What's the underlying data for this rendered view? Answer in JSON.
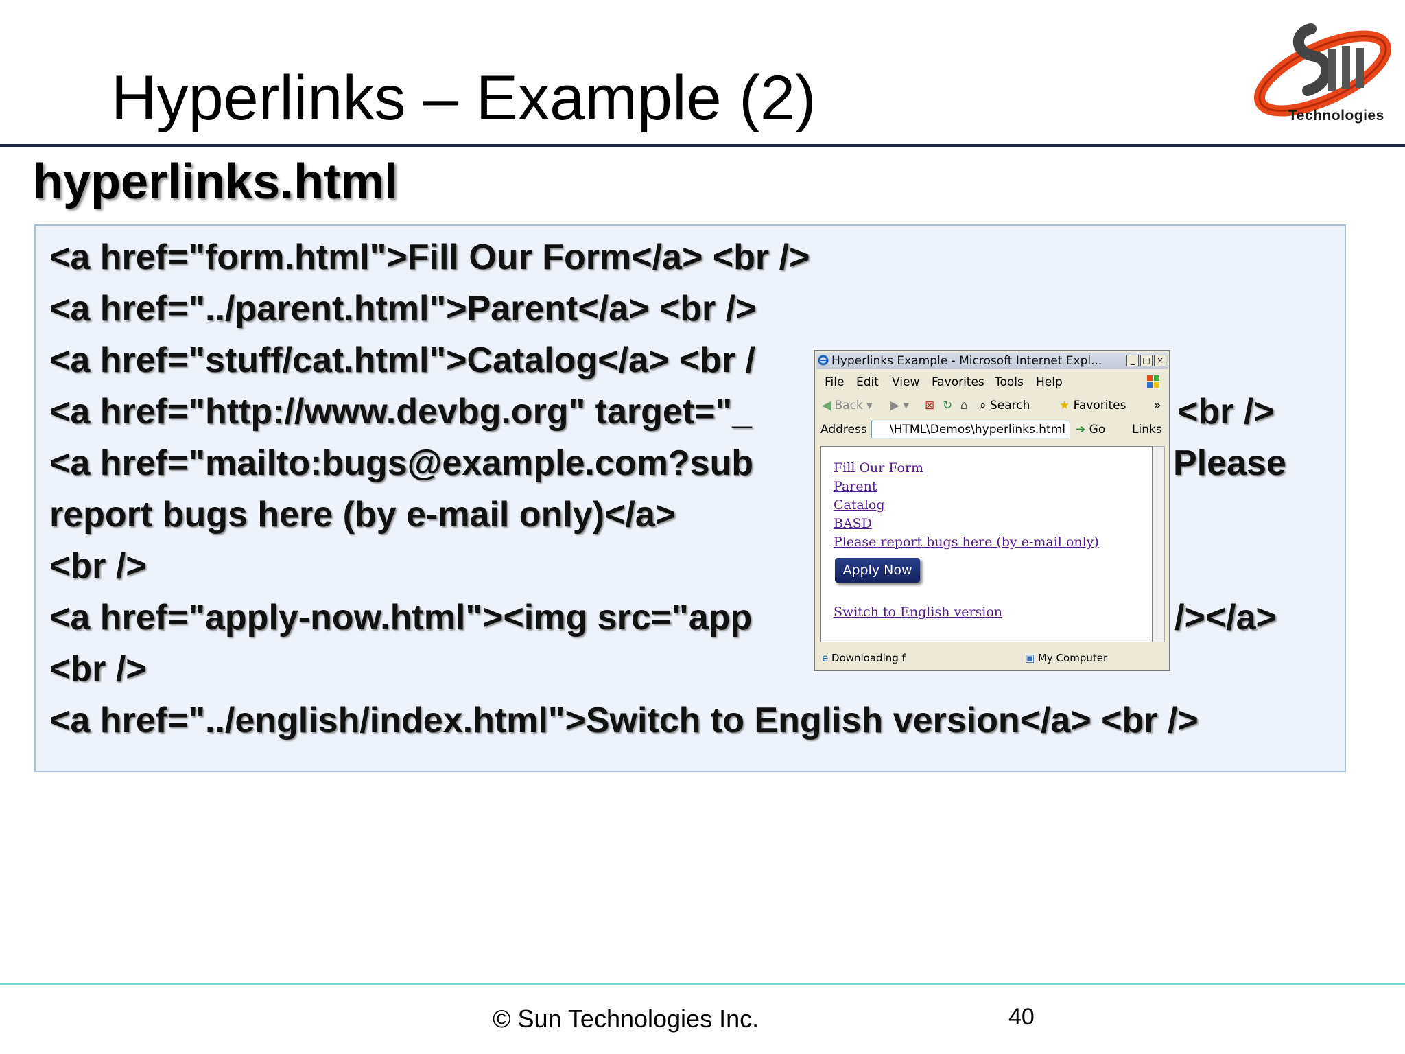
{
  "slide": {
    "title": "Hyperlinks – Example (2)",
    "logo_text": "Technologies",
    "subtitle": "hyperlinks.html",
    "code_lines": [
      "<a href=\"form.html\">Fill Our Form</a> <br />",
      "<a href=\"../parent.html\">Parent</a> <br />",
      "<a href=\"stuff/cat.html\">Catalog</a> <br /",
      "<a href=\"http://www.devbg.org\" target=\"_",
      "<a href=\"mailto:bugs@example.com?sub",
      "report bugs here (by e-mail only)</a>",
      "<br />",
      "<a href=\"apply-now.html\"><img src=\"app",
      "<br />",
      "<a href=\"../english/index.html\">Switch to English version</a> <br />"
    ],
    "code_right_fragments": {
      "line4": "<br />",
      "line5": "Please",
      "line8": "/></a>"
    },
    "footer": "© Sun Technologies Inc.",
    "page_number": "40"
  },
  "browser": {
    "title": "Hyperlinks Example - Microsoft Internet Expl...",
    "menu": [
      "File",
      "Edit",
      "View",
      "Favorites",
      "Tools",
      "Help"
    ],
    "toolbar": {
      "back": "Back",
      "search": "Search",
      "favorites": "Favorites"
    },
    "address_label": "Address",
    "address_value": "\\HTML\\Demos\\hyperlinks.html",
    "go_label": "Go",
    "links_label": "Links",
    "links": [
      "Fill Our Form",
      "Parent",
      "Catalog",
      "BASD",
      "Please report bugs here (by e-mail only)"
    ],
    "apply_button": "Apply Now",
    "english_link": "Switch to English version",
    "status_left": "Downloading f",
    "status_right": "My Computer"
  },
  "colors": {
    "title_rule": "#1b2743",
    "codebox_bg": "#eef3fb",
    "codebox_border": "#a9c0de",
    "visited_link": "#551a8b",
    "logo_orange": "#e8461b"
  },
  "icons": [
    "sun-technologies-logo",
    "ie-icon",
    "back-icon",
    "forward-icon",
    "stop-icon",
    "refresh-icon",
    "home-icon",
    "search-icon",
    "favorites-star-icon",
    "go-arrow-icon",
    "my-computer-icon",
    "windows-flag-icon"
  ]
}
